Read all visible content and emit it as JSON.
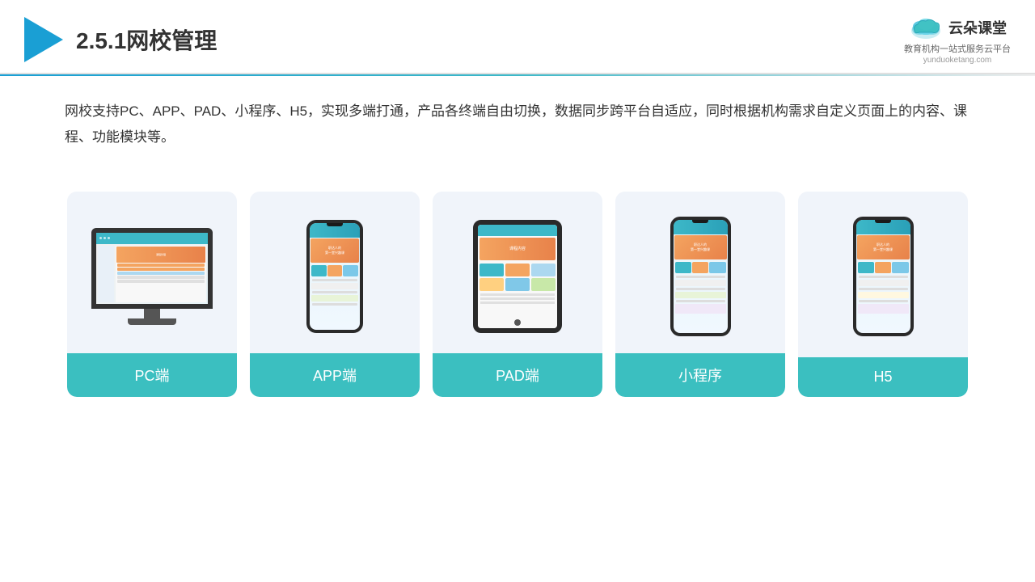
{
  "header": {
    "title": "2.5.1网校管理",
    "brand_name": "云朵课堂",
    "brand_tagline": "教育机构一站\n式服务云平台",
    "brand_url": "yunduoketang.com"
  },
  "description": {
    "text": "网校支持PC、APP、PAD、小程序、H5，实现多端打通，产品各终端自由切换，数据同步跨平台自适应，同时根据机构需求自定义页面上的内容、课程、功能模块等。"
  },
  "cards": [
    {
      "id": "pc",
      "label": "PC端",
      "device_type": "pc"
    },
    {
      "id": "app",
      "label": "APP端",
      "device_type": "phone"
    },
    {
      "id": "pad",
      "label": "PAD端",
      "device_type": "tablet"
    },
    {
      "id": "miniprogram",
      "label": "小程序",
      "device_type": "phone"
    },
    {
      "id": "h5",
      "label": "H5",
      "device_type": "phone"
    }
  ],
  "colors": {
    "accent": "#3bbfc0",
    "header_border": "#1a9fd4",
    "card_bg": "#f0f4fa",
    "label_bg": "#3bbfc0"
  }
}
